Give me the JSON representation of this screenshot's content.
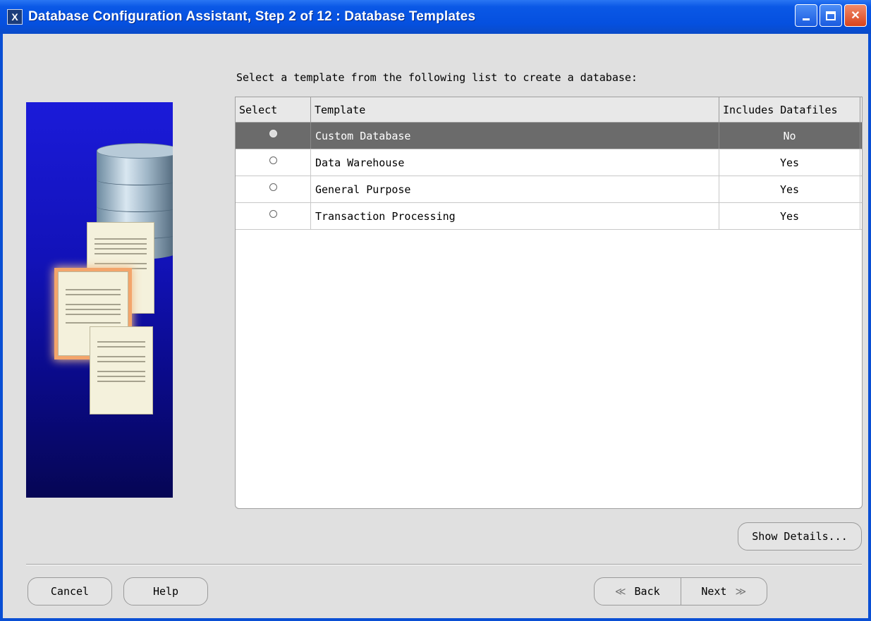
{
  "window": {
    "app_icon": "X",
    "title": "Database Configuration Assistant, Step 2 of 12 : Database Templates",
    "minimize_icon": "minimize-icon",
    "maximize_icon": "maximize-icon",
    "close_label": "✕"
  },
  "main": {
    "prompt": "Select a template from the following list to create a database:",
    "table": {
      "headers": [
        "Select",
        "Template",
        "Includes Datafiles"
      ],
      "rows": [
        {
          "template": "Custom Database",
          "includes_datafiles": "No",
          "selected": true
        },
        {
          "template": "Data Warehouse",
          "includes_datafiles": "Yes",
          "selected": false
        },
        {
          "template": "General Purpose",
          "includes_datafiles": "Yes",
          "selected": false
        },
        {
          "template": "Transaction Processing",
          "includes_datafiles": "Yes",
          "selected": false
        }
      ]
    },
    "show_details_label": "Show Details..."
  },
  "footer": {
    "cancel_label": "Cancel",
    "help_label": "Help",
    "back_label": "Back",
    "next_label": "Next",
    "back_chevron": "≪",
    "next_chevron": "≫"
  },
  "colors": {
    "titlebar": "#0550df",
    "selected_row": "#6b6b6b",
    "illustration_bg": "#1212b8",
    "arrow": "#ff2fd0"
  }
}
